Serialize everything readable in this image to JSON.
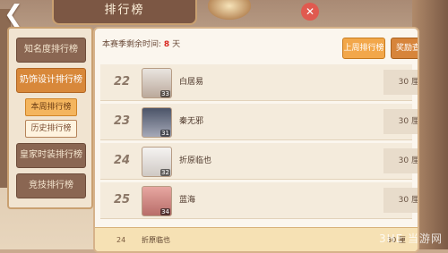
{
  "header": {
    "back_icon": "back-arrow-icon",
    "title": "排行榜",
    "close_icon": "close-icon"
  },
  "sidebar": {
    "items": [
      {
        "label": "知名度排行榜",
        "active": false
      },
      {
        "label": "奶饰设计排行榜",
        "active": true
      },
      {
        "label": "皇家时装排行榜",
        "active": false
      },
      {
        "label": "竞技排行榜",
        "active": false
      }
    ],
    "subtabs": [
      {
        "label": "本周排行榜",
        "active": true
      },
      {
        "label": "历史排行榜",
        "active": false
      }
    ]
  },
  "main": {
    "season_label": "本赛季剩余时间:",
    "season_days": "8",
    "season_unit": "天",
    "btn_last_week": "上周排行榜",
    "btn_reward": "奖励查看",
    "rows": [
      {
        "rank": "22",
        "level": "33",
        "name": "白居易",
        "score": "30 厘"
      },
      {
        "rank": "23",
        "level": "31",
        "name": "秦无邪",
        "score": "30 厘"
      },
      {
        "rank": "24",
        "level": "32",
        "name": "折原临也",
        "score": "30 厘"
      },
      {
        "rank": "25",
        "level": "34",
        "name": "蓝海",
        "score": "30 厘"
      }
    ],
    "my_row": {
      "rank": "24",
      "name": "折原临也",
      "score": "30 厘"
    }
  },
  "watermark": "3HE 当游网",
  "colors": {
    "accent": "#d8883a",
    "days_red": "#d8261f",
    "panel": "#fbf6ee"
  }
}
